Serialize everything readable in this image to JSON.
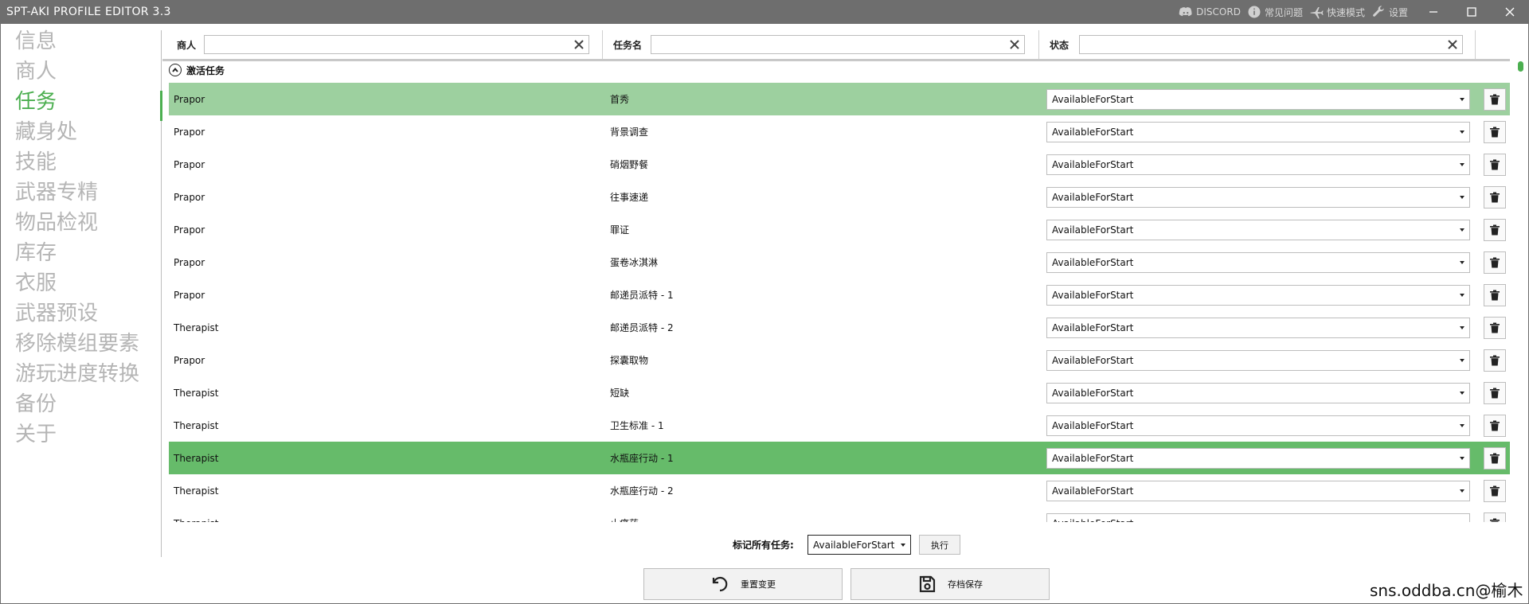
{
  "titlebar": {
    "title": "SPT-AKI PROFILE EDITOR  3.3",
    "discord": "DISCORD",
    "faq": "常见问题",
    "fastmode": "快速模式",
    "settings": "设置"
  },
  "sidebar": {
    "items": [
      {
        "label": "信息"
      },
      {
        "label": "商人"
      },
      {
        "label": "任务"
      },
      {
        "label": "藏身处"
      },
      {
        "label": "技能"
      },
      {
        "label": "武器专精"
      },
      {
        "label": "物品检视"
      },
      {
        "label": "库存"
      },
      {
        "label": "衣服"
      },
      {
        "label": "武器预设"
      },
      {
        "label": "移除模组要素"
      },
      {
        "label": "游玩进度转换"
      },
      {
        "label": "备份"
      },
      {
        "label": "关于"
      }
    ],
    "active_index": 2
  },
  "filters": {
    "trader_label": "商人",
    "quest_label": "任务名",
    "status_label": "状态",
    "trader_value": "",
    "quest_value": "",
    "status_value": ""
  },
  "group": {
    "label": "激活任务"
  },
  "quests": [
    {
      "trader": "Prapor",
      "name": "首秀",
      "status": "AvailableForStart",
      "highlight": "light"
    },
    {
      "trader": "Prapor",
      "name": "背景调查",
      "status": "AvailableForStart",
      "highlight": ""
    },
    {
      "trader": "Prapor",
      "name": "硝烟野餐",
      "status": "AvailableForStart",
      "highlight": ""
    },
    {
      "trader": "Prapor",
      "name": "往事速递",
      "status": "AvailableForStart",
      "highlight": ""
    },
    {
      "trader": "Prapor",
      "name": "罪证",
      "status": "AvailableForStart",
      "highlight": ""
    },
    {
      "trader": "Prapor",
      "name": "蛋卷冰淇淋",
      "status": "AvailableForStart",
      "highlight": ""
    },
    {
      "trader": "Prapor",
      "name": "邮递员派特 - 1",
      "status": "AvailableForStart",
      "highlight": ""
    },
    {
      "trader": "Therapist",
      "name": "邮递员派特 - 2",
      "status": "AvailableForStart",
      "highlight": ""
    },
    {
      "trader": "Prapor",
      "name": "探囊取物",
      "status": "AvailableForStart",
      "highlight": ""
    },
    {
      "trader": "Therapist",
      "name": "短缺",
      "status": "AvailableForStart",
      "highlight": ""
    },
    {
      "trader": "Therapist",
      "name": "卫生标准 - 1",
      "status": "AvailableForStart",
      "highlight": ""
    },
    {
      "trader": "Therapist",
      "name": "水瓶座行动 - 1",
      "status": "AvailableForStart",
      "highlight": "dark"
    },
    {
      "trader": "Therapist",
      "name": "水瓶座行动 - 2",
      "status": "AvailableForStart",
      "highlight": ""
    },
    {
      "trader": "Therapist",
      "name": "止痛药",
      "status": "AvailableForStart",
      "highlight": ""
    }
  ],
  "bulk": {
    "label": "标记所有任务:",
    "selected": "AvailableForStart",
    "execute": "执行"
  },
  "actions": {
    "reset": "重置变更",
    "save": "存档保存"
  },
  "watermark": "sns.oddba.cn@榆木",
  "colors": {
    "accent": "#4caf50",
    "row_highlight_light": "#9dd09f",
    "row_highlight_dark": "#66bb6a",
    "titlebar": "#6e6e6e"
  }
}
